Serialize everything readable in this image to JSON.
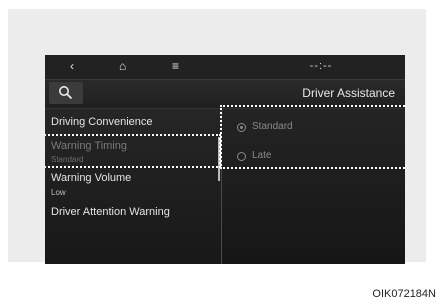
{
  "topbar": {
    "back_icon": "‹",
    "home_icon": "⌂",
    "menu_icon": "≡",
    "clock": "--:--"
  },
  "header": {
    "search_icon": "search-icon",
    "title": "Driver Assistance"
  },
  "menu": {
    "items": [
      {
        "label": "Driving Convenience",
        "sub": ""
      },
      {
        "label": "Warning Timing",
        "sub": "Standard"
      },
      {
        "label": "Warning Volume",
        "sub": "Low"
      },
      {
        "label": "Driver Attention Warning",
        "sub": ""
      }
    ]
  },
  "options": {
    "items": [
      {
        "label": "Standard",
        "selected": true
      },
      {
        "label": "Late",
        "selected": false
      }
    ]
  },
  "caption": "OIK072184N",
  "colors": {
    "screen_bg": "#1c1c1c",
    "highlight": "#ffffff",
    "panel_bg": "#ececec"
  }
}
